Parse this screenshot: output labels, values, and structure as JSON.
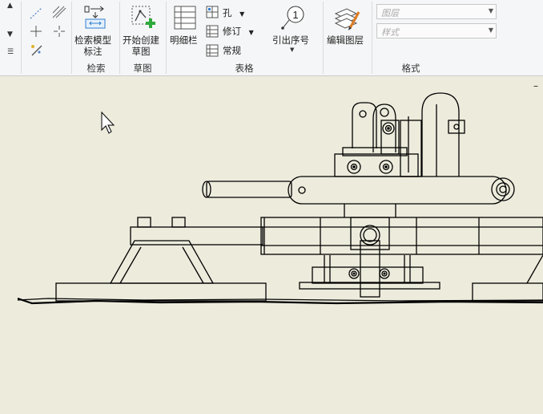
{
  "ribbon": {
    "retrieve_model_annotation": "检索模型\n标注",
    "start_new_sketch": "开始创建\n草图",
    "bom_table": "明细栏",
    "hole": "孔",
    "revision": "修订",
    "regular": "常规",
    "balloon": "引出序号",
    "edit_layer": "编辑图层",
    "layer_placeholder": "图层",
    "style_placeholder": "样式"
  },
  "groups": {
    "retrieve": "检索",
    "sketch": "草图",
    "table": "表格",
    "format": "格式"
  },
  "icons": {
    "balloon_number": "1"
  },
  "canvas": {
    "minimize_glyph": "–",
    "background_color": "#edebdc",
    "line_color": "#000000"
  }
}
